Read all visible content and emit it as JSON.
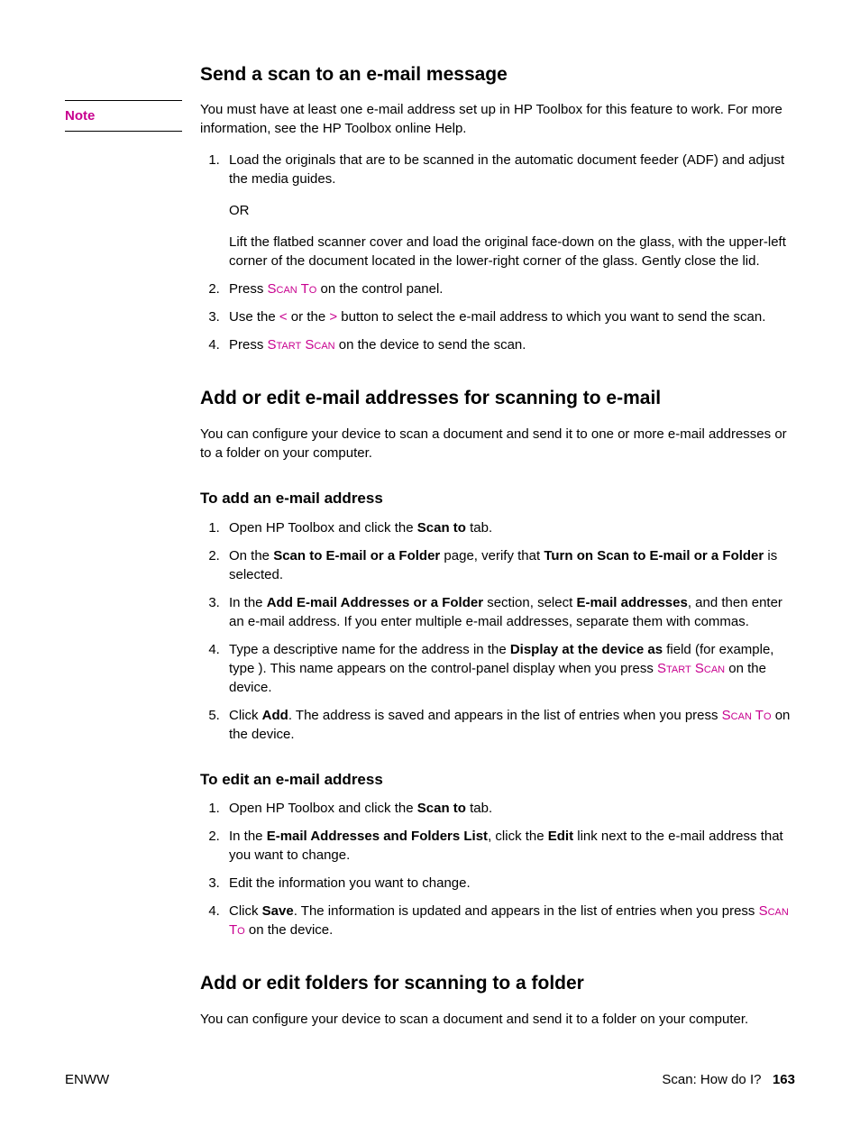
{
  "sections": {
    "s1": {
      "heading": "Send a scan to an e-mail message",
      "noteLabel": "Note",
      "noteBody": "You must have at least one e-mail address set up in HP Toolbox for this feature to work. For more information, see the HP Toolbox online Help.",
      "step1a": "Load the originals that are to be scanned in the automatic document feeder (ADF) and adjust the media guides.",
      "step1or": "OR",
      "step1b": "Lift the flatbed scanner cover and load the original face-down on the glass, with the upper-left corner of the document located in the lower-right corner of the glass. Gently close the lid.",
      "step2_pre": "Press ",
      "step2_btn": "Scan To",
      "step2_post": " on the control panel.",
      "step3_pre": "Use the ",
      "step3_lt": "<",
      "step3_mid": " or the ",
      "step3_gt": ">",
      "step3_post": " button to select the e-mail address to which you want to send the scan.",
      "step4_pre": "Press ",
      "step4_btn": "Start Scan",
      "step4_post": " on the device to send the scan."
    },
    "s2": {
      "heading": "Add or edit e-mail addresses for scanning to e-mail",
      "intro": "You can configure your device to scan a document and send it to one or more e-mail addresses or to a folder on your computer.",
      "addHeading": "To add an e-mail address",
      "add1_pre": "Open HP Toolbox and click the ",
      "add1_b": "Scan to",
      "add1_post": " tab.",
      "add2_pre": "On the ",
      "add2_b1": "Scan to E-mail or a Folder",
      "add2_mid": " page, verify that ",
      "add2_b2": "Turn on Scan to E-mail or a Folder",
      "add2_post": " is selected.",
      "add3_pre": "In the ",
      "add3_b1": "Add E-mail Addresses or a Folder",
      "add3_mid": " section, select ",
      "add3_b2": "E-mail addresses",
      "add3_post": ", and then enter an e-mail address. If you enter multiple e-mail addresses, separate them with commas.",
      "add4_pre": "Type a descriptive name for the address in the ",
      "add4_b": "Display at the device as",
      "add4_mid": " field (for example, type                            ). This name appears on the control-panel display when you press ",
      "add4_btn": "Start Scan",
      "add4_post": " on the device.",
      "add5_pre": "Click ",
      "add5_b": "Add",
      "add5_mid": ". The address is saved and appears in the list of entries when you press ",
      "add5_btn": "Scan To",
      "add5_post": " on the device.",
      "editHeading": "To edit an e-mail address",
      "edit1_pre": "Open HP Toolbox and click the ",
      "edit1_b": "Scan to",
      "edit1_post": " tab.",
      "edit2_pre": "In the ",
      "edit2_b1": "E-mail Addresses and Folders List",
      "edit2_mid": ", click the ",
      "edit2_b2": "Edit",
      "edit2_post": " link next to the e-mail address that you want to change.",
      "edit3": "Edit the information you want to change.",
      "edit4_pre": "Click ",
      "edit4_b": "Save",
      "edit4_mid": ". The information is updated and appears in the list of entries when you press ",
      "edit4_btn": "Scan To",
      "edit4_post": " on the device."
    },
    "s3": {
      "heading": "Add or edit folders for scanning to a folder",
      "intro": "You can configure your device to scan a document and send it to a folder on your computer."
    }
  },
  "footer": {
    "left": "ENWW",
    "rightText": "Scan: How do I?",
    "page": "163"
  }
}
